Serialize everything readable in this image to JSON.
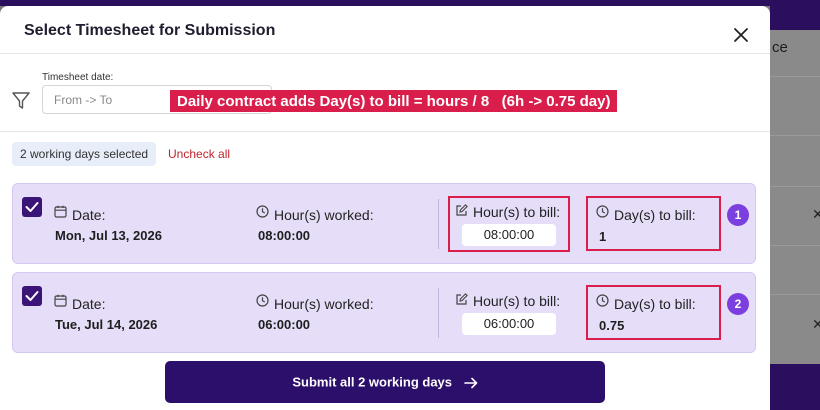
{
  "modal": {
    "title": "Select Timesheet for Submission"
  },
  "filter": {
    "label": "Timesheet date:",
    "placeholder": "From -> To"
  },
  "annotation": "Daily contract adds Day(s) to bill = hours / 8   (6h -> 0.75 day)",
  "selection": {
    "count_label": "2 working days selected",
    "uncheck_label": "Uncheck all"
  },
  "field_labels": {
    "date": "Date:",
    "hours_worked": "Hour(s) worked:",
    "hours_to_bill": "Hour(s) to bill:",
    "days_to_bill": "Day(s) to bill:"
  },
  "entries": [
    {
      "date": "Mon, Jul 13, 2026",
      "hours_worked": "08:00:00",
      "hours_to_bill": "08:00:00",
      "days_to_bill": "1",
      "marker": "1",
      "checked": true
    },
    {
      "date": "Tue, Jul 14, 2026",
      "hours_worked": "06:00:00",
      "hours_to_bill": "06:00:00",
      "days_to_bill": "0.75",
      "marker": "2",
      "checked": true
    }
  ],
  "submit_label": "Submit all 2 working days",
  "background": {
    "partial_text": "ce"
  },
  "colors": {
    "accent": "#2c0f6a",
    "card_bg": "#e6ddf8",
    "highlight": "#d91e4c",
    "marker": "#7b3fdf",
    "danger_link": "#c0242c"
  },
  "icons": [
    "close-icon",
    "filter-icon",
    "calendar-icon",
    "clock-icon",
    "edit-icon",
    "arrow-right-icon",
    "check-icon"
  ]
}
